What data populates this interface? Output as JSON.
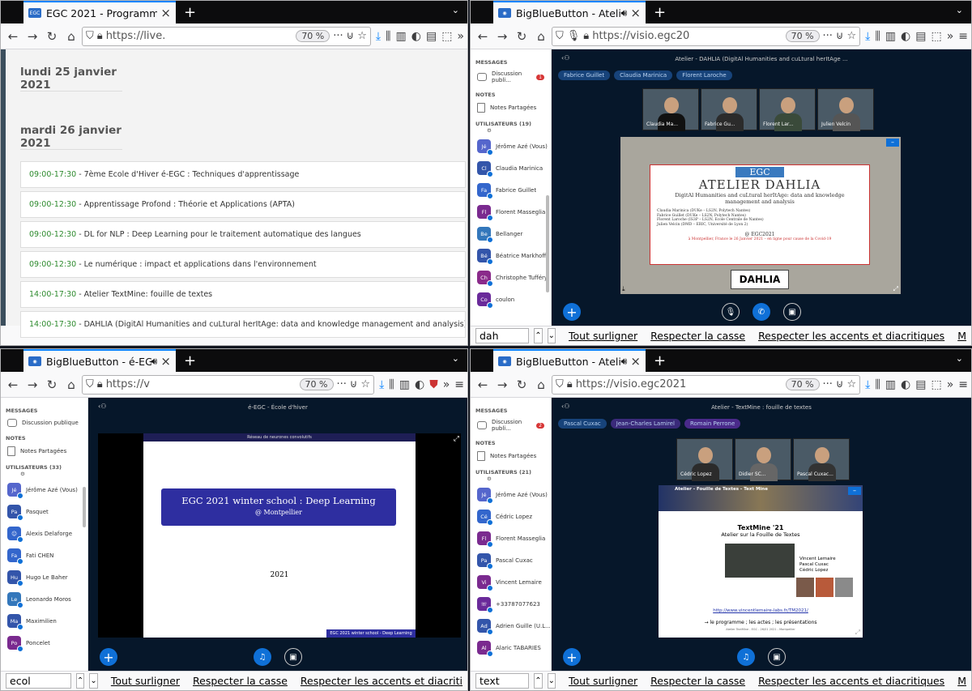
{
  "windows": [
    {
      "tab_title": "EGC 2021 - Programme",
      "favicon": "egc-icon",
      "url": "https://live.",
      "zoom": "70 %",
      "day1": "lundi 25 janvier 2021",
      "day2": "mardi 26 janvier 2021",
      "events": [
        {
          "time": "09:00-17:30",
          "title": "- 7ème Ecole d'Hiver é-EGC : Techniques d'apprentissage"
        },
        {
          "time": "09:00-12:30",
          "title": "- Apprentissage Profond : Théorie et Applications (APTA)"
        },
        {
          "time": "09:00-12:30",
          "title": "- DL for NLP : Deep Learning pour le traitement automatique des langues"
        },
        {
          "time": "09:00-12:30",
          "title": "- Le numérique : impact et applications dans l'environnement"
        },
        {
          "time": "14:00-17:30",
          "title": "- Atelier TextMine: fouille de textes"
        },
        {
          "time": "14:00-17:30",
          "title": "- DAHLIA (DigitAl Humanities and cuLtural herItAge: data and knowledge management and analysis)"
        }
      ]
    },
    {
      "tab_title": "BigBlueButton - Atelie",
      "url": "https://visio.egc20",
      "zoom": "70 %",
      "find": "dah",
      "messages": "MESSAGES",
      "public_chat": "Discussion publi...",
      "chat_badge": "1",
      "notes": "NOTES",
      "shared_notes": "Notes Partagées",
      "users_header": "UTILISATEURS (19)",
      "users": [
        {
          "initials": "Jé",
          "name": "Jérôme Azé (Vous)",
          "color": "#5566cc"
        },
        {
          "initials": "Cl",
          "name": "Claudia Marinica",
          "color": "#3355aa"
        },
        {
          "initials": "Fa",
          "name": "Fabrice Guillet",
          "color": "#3366cc"
        },
        {
          "initials": "Fl",
          "name": "Florent Masseglia",
          "color": "#7a2a8f"
        },
        {
          "initials": "Be",
          "name": "Bellanger",
          "color": "#3377bb"
        },
        {
          "initials": "Bé",
          "name": "Béatrice Markhoff",
          "color": "#3355aa"
        },
        {
          "initials": "Ch",
          "name": "Christophe Tufféry",
          "color": "#8a2a8a"
        },
        {
          "initials": "Co",
          "name": "coulon",
          "color": "#6a2a9a"
        }
      ],
      "meeting_title": "Atelier - DAHLIA (DigitAl Humanities and cuLtural herItAge ...",
      "talkers": [
        "Fabrice Guillet",
        "Claudia Marinica",
        "Florent Laroche"
      ],
      "cams": [
        "Claudia Ma...",
        "Fabrice Gu...",
        "Florent Lar...",
        "Julien Velcin"
      ],
      "slide": {
        "logo": "EGC",
        "title": "ATELIER DAHLIA",
        "subtitle": "DigitAl Humanities and cuLtural herItAge: data and knowledge management and analysis",
        "authors": [
          "Claudia Marinica (DUKe – LS2N, Polytech Nantes)",
          "Fabrice Guillet (DUKe – LS2N, Polytech Nantes)",
          "Florent Laroche (IS3P – LS2N, Ecole Centrale de Nantes)",
          "Julien Velcin (DMD – ERIC, Université de Lyon 2)"
        ],
        "event": "@ EGC2021",
        "date_text": "à Montpellier, France le 26 Janvier 2021 – en ligne pour cause de la Covid-19",
        "bottom_logo": "DAHLIA"
      }
    },
    {
      "tab_title": "BigBlueButton - é-EGC",
      "url": "https://v",
      "zoom": "70 %",
      "find": "ecol",
      "messages": "MESSAGES",
      "public_chat": "Discussion publique",
      "notes": "NOTES",
      "shared_notes": "Notes Partagées",
      "users_header": "UTILISATEURS (33)",
      "users": [
        {
          "initials": "Jé",
          "name": "Jérôme Azé (Vous)",
          "color": "#5566cc"
        },
        {
          "initials": "Pa",
          "name": "Pasquet",
          "color": "#3355aa"
        },
        {
          "initials": "☺",
          "name": "Alexis Delaforge",
          "color": "#3366cc"
        },
        {
          "initials": "Fa",
          "name": "Fati CHEN",
          "color": "#3366cc"
        },
        {
          "initials": "Hu",
          "name": "Hugo Le Baher",
          "color": "#3355aa"
        },
        {
          "initials": "Le",
          "name": "Leonardo Moros",
          "color": "#3377bb"
        },
        {
          "initials": "Ma",
          "name": "Maximilien",
          "color": "#3355aa"
        },
        {
          "initials": "Po",
          "name": "Poncelet",
          "color": "#7a2a8f"
        }
      ],
      "meeting_title": "é-EGC - École d'hiver",
      "slide": {
        "header": "Réseau de neurones convolutifs",
        "title": "EGC 2021 winter school : Deep Learning",
        "subtitle": "@ Montpellier",
        "year": "2021",
        "footer": "EGC 2021 winter school - Deep Learning"
      }
    },
    {
      "tab_title": "BigBlueButton - Atelie",
      "url": "https://visio.egc2021",
      "zoom": "70 %",
      "find": "text",
      "messages": "MESSAGES",
      "public_chat": "Discussion publi...",
      "chat_badge": "2",
      "notes": "NOTES",
      "shared_notes": "Notes Partagées",
      "users_header": "UTILISATEURS (21)",
      "users": [
        {
          "initials": "Jé",
          "name": "Jérôme Azé (Vous)",
          "color": "#5566cc"
        },
        {
          "initials": "Cé",
          "name": "Cédric Lopez",
          "color": "#3366cc"
        },
        {
          "initials": "Fl",
          "name": "Florent Masseglia",
          "color": "#7a2a8f"
        },
        {
          "initials": "Pa",
          "name": "Pascal Cuxac",
          "color": "#3355aa"
        },
        {
          "initials": "Vi",
          "name": "Vincent Lemaire",
          "color": "#7a2a8f"
        },
        {
          "initials": "☏",
          "name": "+33787077623",
          "color": "#6a2a9a"
        },
        {
          "initials": "Ad",
          "name": "Adrien Guille (U.L...",
          "color": "#3355aa"
        },
        {
          "initials": "Al",
          "name": "Alaric TABARIES",
          "color": "#7a2a8f"
        }
      ],
      "meeting_title": "Atelier - TextMine : fouille de textes",
      "talkers": [
        "Pascal Cuxac",
        "Jean-Charles Lamirel",
        "Romain Perrone"
      ],
      "cams": [
        "Cédric Lopez",
        "Didier SC...",
        "Pascal Cuxac..."
      ],
      "slide": {
        "header": "Atelier - Fouille de Textes - Text Mine",
        "title": "TextMine '21",
        "subtitle": "Atelier sur la Fouille de Textes",
        "people": [
          "Vincent Lemaire",
          "Pascal Cuxac",
          "Cédric Lopez"
        ],
        "link": "http://www.vincentlemaire-labs.fr/TM2021/",
        "bottom": "→ le programme ; les actes ; les présentations",
        "tiny": "Atelier TextMine - EGC - 26/01 2021 - Montpellier"
      }
    }
  ],
  "find_options": [
    "Tout surligner",
    "Respecter la casse",
    "Respecter les accents et diacritiques"
  ],
  "find_options_short": [
    "Tout surligner",
    "Respecter la casse",
    "Respecter les accents et diacriti"
  ],
  "find_extra": "M"
}
